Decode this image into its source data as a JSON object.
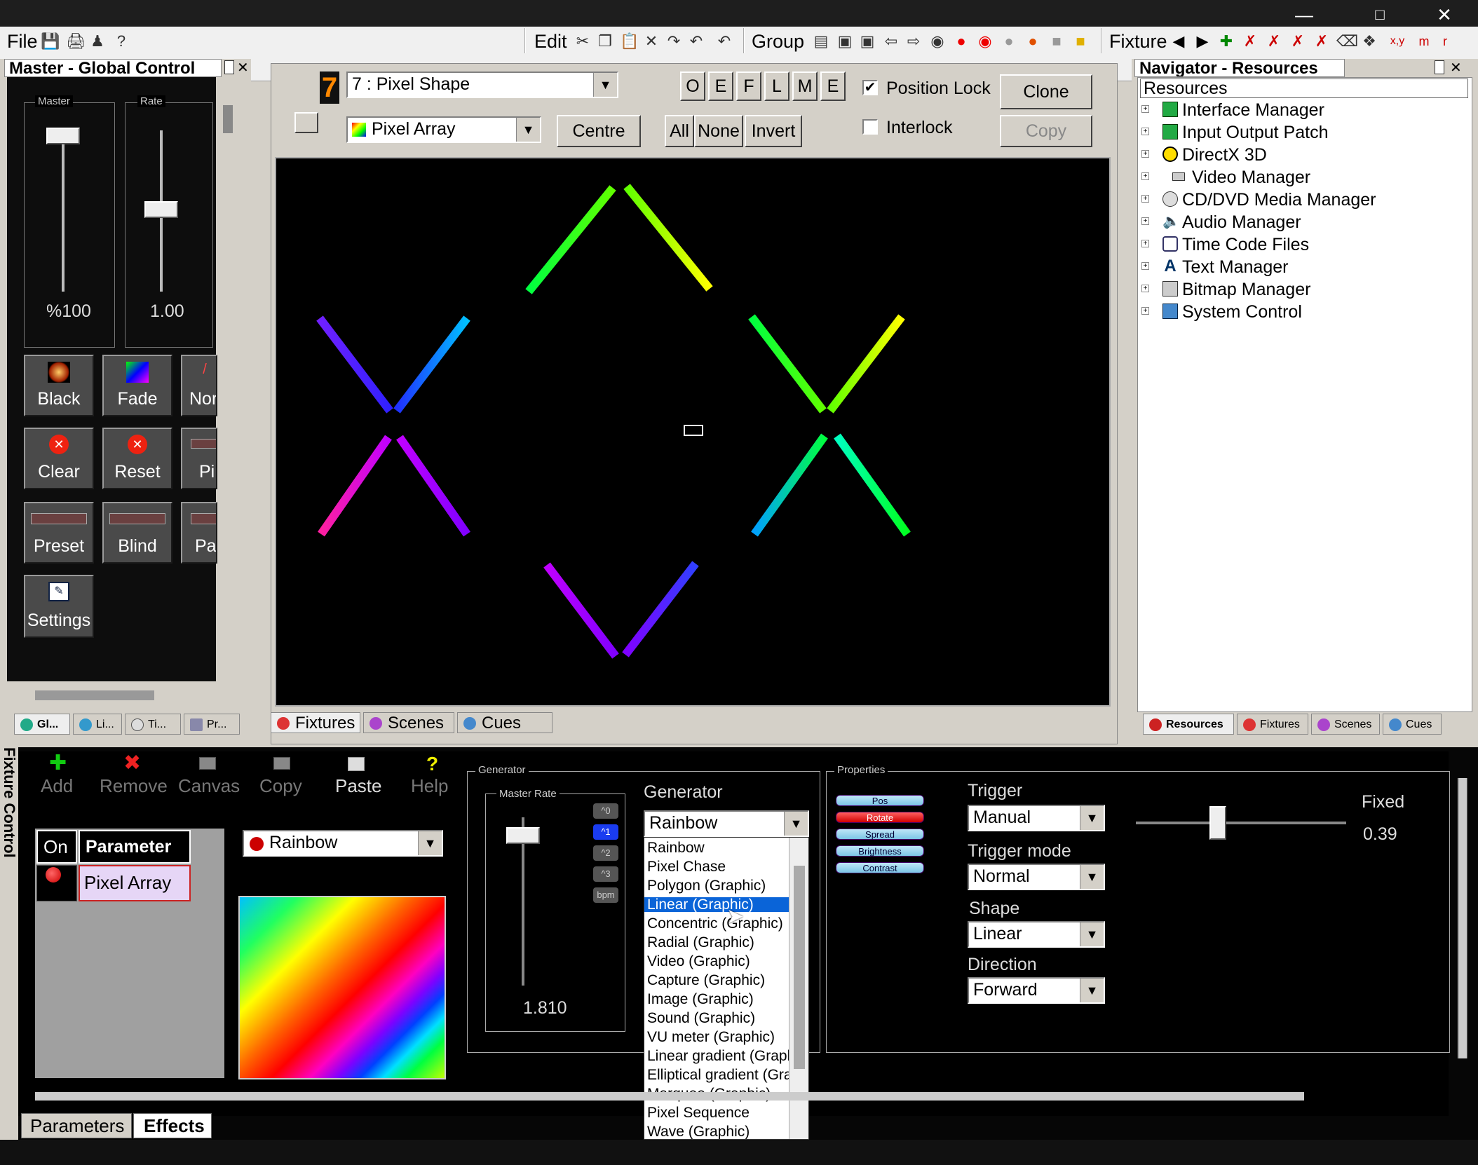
{
  "titlebar": {
    "controls": [
      "min-icon",
      "max-icon",
      "close-icon"
    ]
  },
  "menubar": {
    "file": "File",
    "edit": "Edit",
    "group": "Group",
    "fixture": "Fixture",
    "fixture_tb_xy": "x,y",
    "fixture_tb_m": "m",
    "fixture_tb_r": "r"
  },
  "master_panel": {
    "title": "Master - Global Control",
    "master_label": "Master",
    "master_value": "%100",
    "master_level": 1.0,
    "rate_label": "Rate",
    "rate_value": "1.00",
    "rate_level": 0.5,
    "buttons": [
      {
        "label": "Black",
        "icon": "black-icon"
      },
      {
        "label": "Fade",
        "icon": "fade-icon"
      },
      {
        "label": "Nor",
        "icon": "normal-icon"
      },
      {
        "label": "Clear",
        "icon": "clear-icon"
      },
      {
        "label": "Reset",
        "icon": "reset-icon"
      },
      {
        "label": "Pi",
        "icon": "pixel-icon"
      },
      {
        "label": "Preset",
        "icon": "preset-icon"
      },
      {
        "label": "Blind",
        "icon": "blind-icon"
      },
      {
        "label": "Pa",
        "icon": "pause-icon"
      },
      {
        "label": "Settings",
        "icon": "settings-icon"
      }
    ],
    "tabs": [
      "Gl...",
      "Li...",
      "Ti...",
      "Pr..."
    ]
  },
  "fixture_panel": {
    "fixture_number": "7",
    "fixture_select": "7 : Pixel Shape",
    "mode_select": "Pixel Array",
    "centre": "Centre",
    "letters": [
      "O",
      "E",
      "F",
      "L",
      "M",
      "E"
    ],
    "all": "All",
    "none": "None",
    "invert": "Invert",
    "position_lock": "Position Lock",
    "position_lock_checked": true,
    "interlock": "Interlock",
    "interlock_checked": false,
    "clone": "Clone",
    "copy": "Copy",
    "tabs": [
      "Fixtures",
      "Scenes",
      "Cues"
    ]
  },
  "navigator": {
    "title": "Navigator - Resources",
    "root": "Resources",
    "items": [
      "Interface Manager",
      "Input Output Patch",
      "DirectX 3D",
      "Video Manager",
      "CD/DVD Media Manager",
      "Audio Manager",
      "Time Code Files",
      "Text Manager",
      "Bitmap Manager",
      "System Control"
    ],
    "tabs": [
      "Resources",
      "Fixtures",
      "Scenes",
      "Cues"
    ]
  },
  "fixture_control": {
    "side_title": "Fixture Control",
    "toolbar": [
      "Add",
      "Remove",
      "Canvas",
      "Copy",
      "Paste",
      "Help"
    ],
    "table": {
      "col_on": "On",
      "col_param": "Parameter",
      "row_param": "Pixel Array"
    },
    "effect_select": "Rainbow",
    "generator_group": "Generator",
    "master_rate_label": "Master Rate",
    "master_rate_value": "1.810",
    "rate_buttons": [
      "^0",
      "^1",
      "^2",
      "^3",
      "bpm"
    ],
    "generator_label": "Generator",
    "generator_value": "Rainbow",
    "generator_options": [
      "Rainbow",
      "Pixel Chase",
      "Polygon (Graphic)",
      "Linear (Graphic)",
      "Concentric (Graphic)",
      "Radial (Graphic)",
      "Video (Graphic)",
      "Capture (Graphic)",
      "Image (Graphic)",
      "Sound (Graphic)",
      "VU meter (Graphic)",
      "Linear gradient (Graphic)",
      "Elliptical gradient (Graphic)",
      "Marquee (Graphic)",
      "Pixel Sequence",
      "Wave (Graphic)"
    ],
    "highlighted_option": "Linear (Graphic)",
    "properties_group": "Properties",
    "property_buttons": [
      "Pos",
      "Rotate",
      "Spread",
      "Brightness",
      "Contrast"
    ],
    "active_property": "Rotate",
    "trigger_label": "Trigger",
    "trigger_value": "Manual",
    "trigger_mode_label": "Trigger mode",
    "trigger_mode_value": "Normal",
    "shape_label": "Shape",
    "shape_value": "Linear",
    "direction_label": "Direction",
    "direction_value": "Forward",
    "fixed_label": "Fixed",
    "fixed_value": "0.39",
    "tabs": [
      "Parameters",
      "Effects"
    ]
  },
  "colors": {
    "accent_blue": "#0a64d8",
    "rotate_active": "#e02020",
    "pill": "#9fd9f0"
  }
}
